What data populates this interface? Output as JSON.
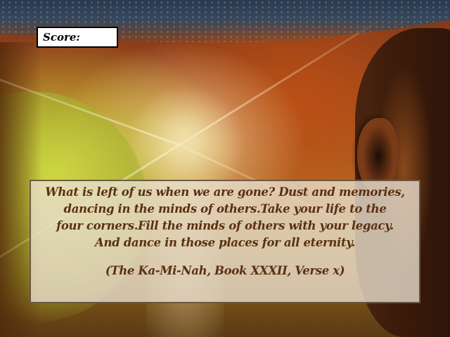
{
  "hud": {
    "score_label": "Score:",
    "score_value": ""
  },
  "quote": {
    "lines": [
      "What is left of us when we are gone? Dust and memories,",
      "dancing in the minds of others.Take your life to the",
      "four corners.Fill the minds of others with your legacy.",
      "And dance in those places for all eternity."
    ],
    "citation": "(The Ka-Mi-Nah, Book XXXII, Verse x)"
  },
  "colors": {
    "quote_text": "#5a3112",
    "quote_panel": "#e8decd",
    "score_box_bg": "#ffffff",
    "score_box_border": "#000000"
  }
}
